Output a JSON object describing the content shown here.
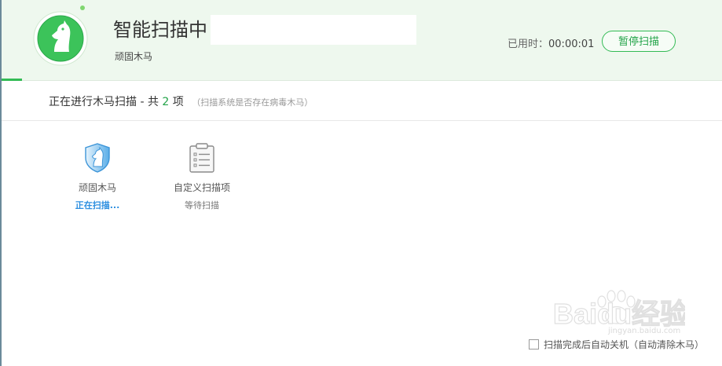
{
  "header": {
    "title": "智能扫描中",
    "current_item": "顽固木马",
    "elapsed_label": "已用时：",
    "elapsed_value": "00:00:01",
    "pause_button": "暂停扫描",
    "progress_fraction": 0.028
  },
  "status": {
    "prefix": "正在进行木马扫描 - 共",
    "count": "2",
    "suffix": "项",
    "hint": "（扫描系统是否存在病毒木马）"
  },
  "scan_items": [
    {
      "name": "顽固木马",
      "state": "正在扫描...",
      "icon": "shield-horse-icon"
    },
    {
      "name": "自定义扫描项",
      "state": "等待扫描",
      "icon": "clipboard-list-icon"
    }
  ],
  "footer": {
    "checkbox_label": "扫描完成后自动关机（自动清除木马）",
    "checked": false
  },
  "watermark": {
    "text": "Baidu经验",
    "sub": "jingyan.baidu.com"
  },
  "colors": {
    "accent_green": "#33bb55",
    "header_bg": "#eef8ee",
    "scanning_blue": "#2d8fe0"
  }
}
